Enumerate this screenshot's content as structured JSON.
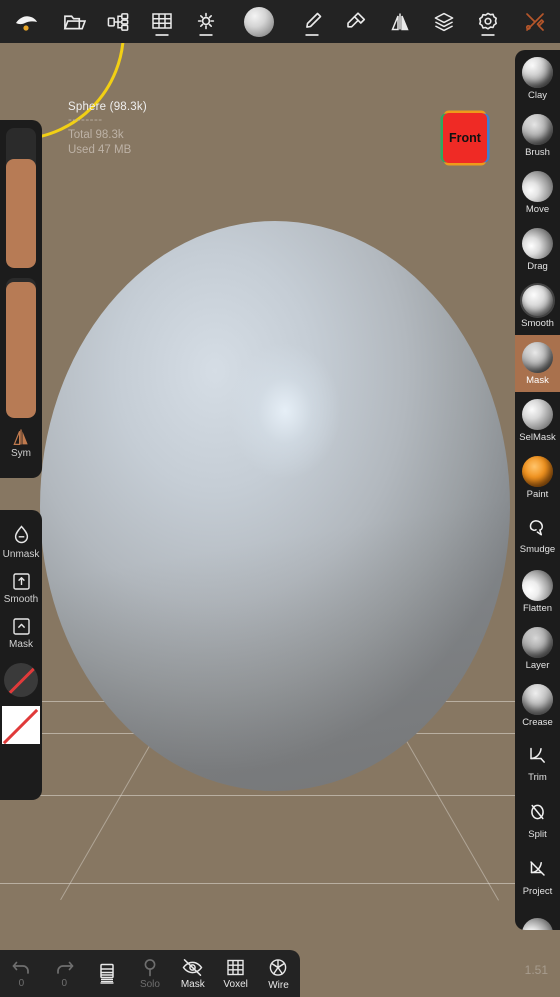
{
  "app": {
    "fps_label": "1.51"
  },
  "topbar": {
    "items": [
      {
        "name": "sculpt-logo-icon",
        "label": "Sculpt",
        "underline": false
      },
      {
        "name": "folder-open-icon",
        "label": "Files",
        "underline": false
      },
      {
        "name": "scene-graph-icon",
        "label": "Scene",
        "underline": false
      },
      {
        "name": "grid-icon",
        "label": "Grid",
        "underline": true
      },
      {
        "name": "light-icon",
        "label": "Light",
        "underline": true
      },
      {
        "name": "material-sphere-icon",
        "label": "Material",
        "underline": false
      },
      {
        "name": "brush-icon",
        "label": "Brush",
        "underline": true
      },
      {
        "name": "stamp-icon",
        "label": "Stamp",
        "underline": false
      },
      {
        "name": "mirror-icon",
        "label": "Mirror",
        "underline": false
      },
      {
        "name": "layers-icon",
        "label": "Layers",
        "underline": false
      },
      {
        "name": "gear-icon",
        "label": "Settings",
        "underline": true
      },
      {
        "name": "tools-icon",
        "label": "Tools",
        "underline": false
      }
    ]
  },
  "viewport": {
    "scene": {
      "object_title": "Sphere (98.3k)",
      "divider": "--------",
      "total": "Total 98.3k",
      "used": "Used 47 MB"
    },
    "view_cube": {
      "label": "Front",
      "face_color": "#ef2a25",
      "left_edge_color": "#2fa85e",
      "right_edge_color": "#3d7fd4",
      "top_edge_color": "#ef9a1a"
    },
    "background_color": "#877762",
    "brush_cursor_color": "#f2d014"
  },
  "left_panel": {
    "sliders": [
      {
        "name": "radius-slider",
        "fill_percent": 78,
        "color": "#b77b55"
      },
      {
        "name": "intensity-slider",
        "fill_percent": 97,
        "color": "#b77b55"
      }
    ],
    "symmetry": {
      "label": "Sym",
      "icon": "symmetry-icon"
    }
  },
  "left_panel_secondary": {
    "items": [
      {
        "label": "Unmask",
        "icon": "unmask-drop-icon"
      },
      {
        "label": "Smooth",
        "icon": "smooth-up-icon"
      },
      {
        "label": "Mask",
        "icon": "mask-up-icon"
      }
    ],
    "alpha_swatch": {
      "name": "alpha-swatch",
      "disabled": true
    },
    "stencil_swatch": {
      "name": "stencil-swatch",
      "disabled": true
    },
    "disabled_marker_color": "#e03a3a"
  },
  "right_panel": {
    "active_tool": "Mask",
    "active_color": "#a9714d",
    "tools": [
      {
        "label": "Clay",
        "icon": "clay-brush-icon"
      },
      {
        "label": "Brush",
        "icon": "standard-brush-icon"
      },
      {
        "label": "Move",
        "icon": "move-brush-icon"
      },
      {
        "label": "Drag",
        "icon": "drag-brush-icon"
      },
      {
        "label": "Smooth",
        "icon": "smooth-brush-icon"
      },
      {
        "label": "Mask",
        "icon": "mask-brush-icon"
      },
      {
        "label": "SelMask",
        "icon": "select-mask-icon"
      },
      {
        "label": "Paint",
        "icon": "paint-brush-icon"
      },
      {
        "label": "Smudge",
        "icon": "smudge-icon"
      },
      {
        "label": "Flatten",
        "icon": "flatten-brush-icon"
      },
      {
        "label": "Layer",
        "icon": "layer-brush-icon"
      },
      {
        "label": "Crease",
        "icon": "crease-brush-icon"
      },
      {
        "label": "Trim",
        "icon": "trim-icon"
      },
      {
        "label": "Split",
        "icon": "split-icon"
      },
      {
        "label": "Project",
        "icon": "project-icon"
      }
    ]
  },
  "bottombar": {
    "items": [
      {
        "label": "0",
        "name": "undo-button",
        "icon": "undo-arrow-icon",
        "dim": true,
        "underline": false
      },
      {
        "label": "0",
        "name": "redo-button",
        "icon": "redo-arrow-icon",
        "dim": true,
        "underline": false
      },
      {
        "label": "",
        "name": "layers-button",
        "icon": "book-layers-icon",
        "dim": false,
        "underline": true
      },
      {
        "label": "Solo",
        "name": "solo-button",
        "icon": "magnifier-icon",
        "dim": true,
        "underline": false
      },
      {
        "label": "Mask",
        "name": "mask-toggle",
        "icon": "eye-off-icon",
        "dim": false,
        "underline": false
      },
      {
        "label": "Voxel",
        "name": "voxel-toggle",
        "icon": "voxel-grid-icon",
        "dim": false,
        "underline": false
      },
      {
        "label": "Wire",
        "name": "wire-toggle",
        "icon": "wireframe-icon",
        "dim": false,
        "underline": false
      }
    ]
  }
}
